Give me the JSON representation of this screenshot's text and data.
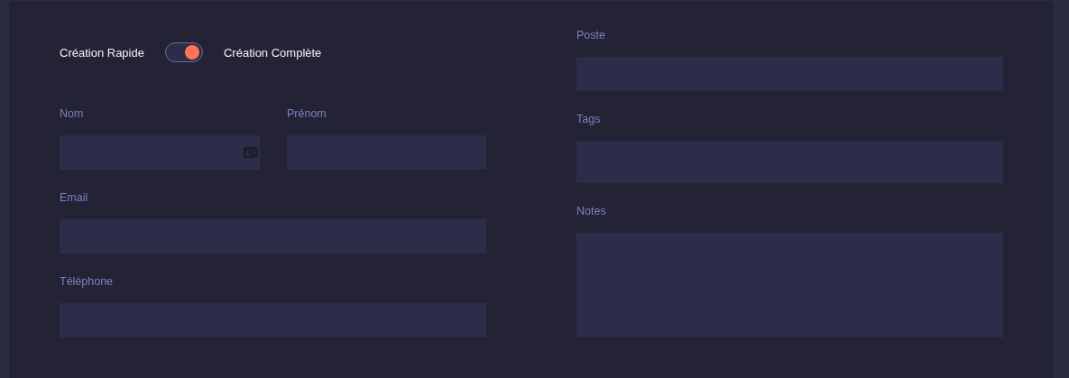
{
  "mode_switch": {
    "left_label": "Création Rapide",
    "right_label": "Création Complète",
    "on": true
  },
  "left_fields": [
    {
      "kind": "pair",
      "items": [
        {
          "label": "Nom",
          "has_icon": true
        },
        {
          "label": "Prénom",
          "has_icon": false
        }
      ]
    },
    {
      "kind": "single",
      "items": [
        {
          "label": "Email",
          "has_icon": false
        }
      ]
    },
    {
      "kind": "single",
      "items": [
        {
          "label": "Téléphone",
          "has_icon": false
        }
      ]
    }
  ],
  "right_fields": [
    {
      "label": "Poste",
      "kind": "input"
    },
    {
      "label": "Tags",
      "kind": "tags"
    },
    {
      "label": "Notes",
      "kind": "textarea"
    }
  ]
}
